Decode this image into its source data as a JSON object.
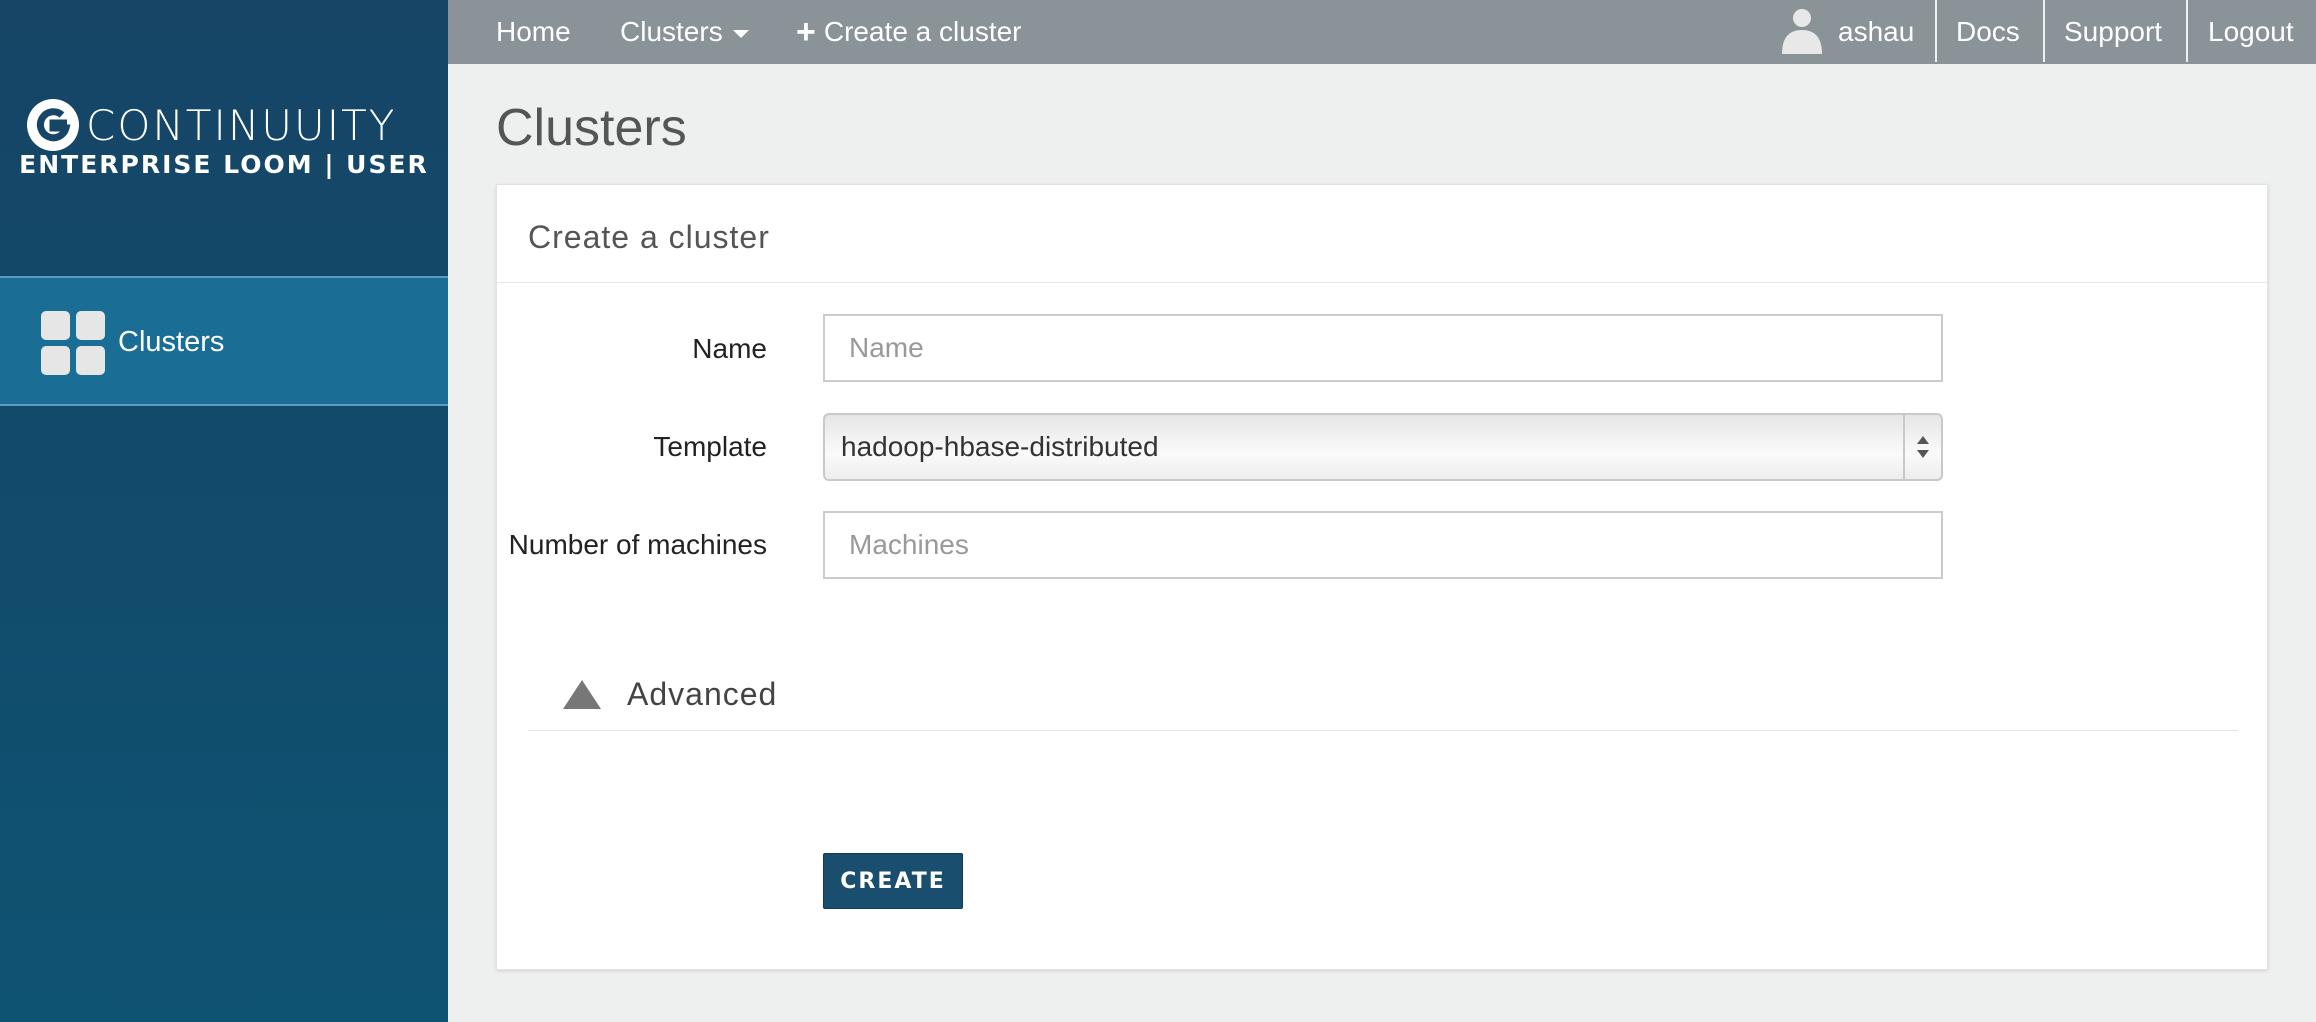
{
  "sidebar": {
    "brand_name": "CONTINUUITY",
    "brand_subtitle": "ENTERPRISE LOOM | USER",
    "items": [
      {
        "label": "Clusters",
        "icon": "grid-icon"
      }
    ]
  },
  "topnav": {
    "home": "Home",
    "clusters": "Clusters",
    "create": "Create a cluster",
    "user": "ashau",
    "docs": "Docs",
    "support": "Support",
    "logout": "Logout"
  },
  "page": {
    "title": "Clusters"
  },
  "form": {
    "panel_title": "Create a cluster",
    "name_label": "Name",
    "name_placeholder": "Name",
    "name_value": "",
    "template_label": "Template",
    "template_value": "hadoop-hbase-distributed",
    "machines_label": "Number of machines",
    "machines_placeholder": "Machines",
    "machines_value": "",
    "advanced_label": "Advanced",
    "create_button": "CREATE"
  },
  "colors": {
    "sidebar": "#124a6b",
    "sidebar_active": "#1a6d94",
    "topnav": "#8a9397",
    "button": "#1a4e6e",
    "background": "#eef0ef"
  }
}
